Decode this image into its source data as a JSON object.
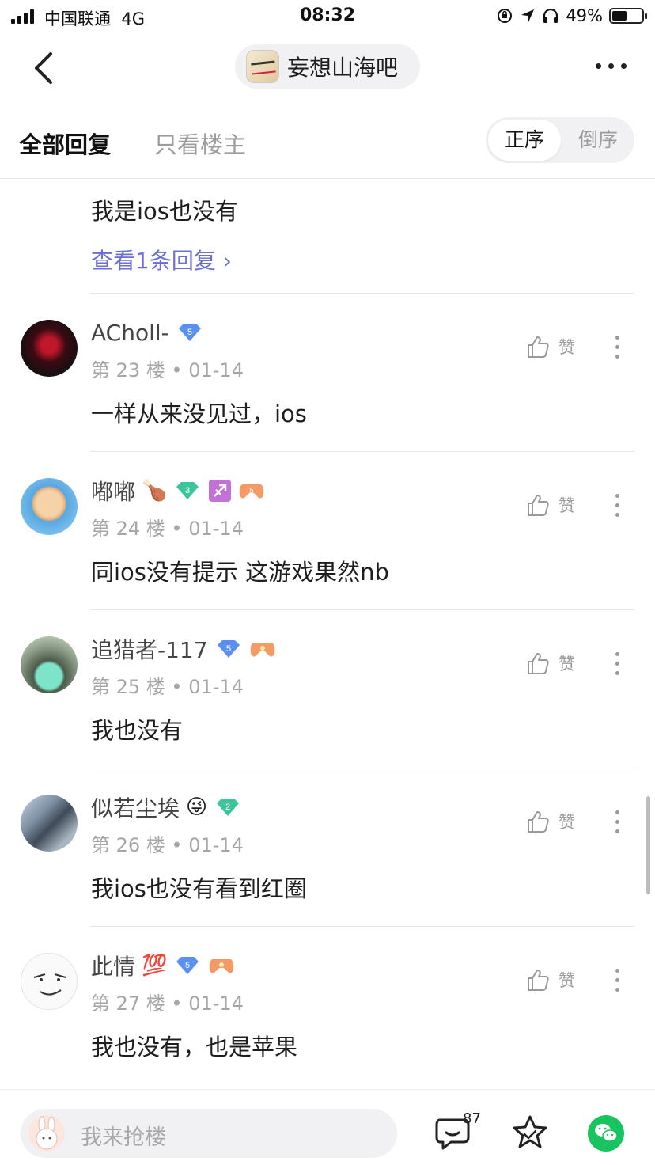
{
  "status_bar": {
    "carrier": "中国联通",
    "network": "4G",
    "time": "08:32",
    "battery": "49%",
    "battery_level": 0.49
  },
  "header": {
    "forum_name": "妄想山海吧"
  },
  "tabs": {
    "all_replies": "全部回复",
    "op_only": "只看楼主",
    "sort_asc": "正序",
    "sort_desc": "倒序"
  },
  "partial_reply": {
    "text": "我是ios也没有",
    "view_replies": "查看1条回复 ›"
  },
  "like_label": "赞",
  "posts": [
    {
      "username": "ACholl-",
      "floor": "第 23 楼",
      "date": "01-14",
      "body": "一样从来没见过，ios",
      "level": "5"
    },
    {
      "username": "嘟嘟",
      "floor": "第 24 楼",
      "date": "01-14",
      "body": "同ios没有提示 这游戏果然nb",
      "level": "3",
      "extra_badge": "5"
    },
    {
      "username": "追猎者-117",
      "floor": "第 25 楼",
      "date": "01-14",
      "body": "我也没有",
      "level": "5"
    },
    {
      "username": "似若尘埃",
      "floor": "第 26 楼",
      "date": "01-14",
      "body": "我ios也没有看到红圈",
      "level": "2"
    },
    {
      "username": "此情",
      "floor": "第 27 楼",
      "date": "01-14",
      "body": "我也没有，也是苹果",
      "level": "5"
    }
  ],
  "bottom_bar": {
    "reply_placeholder": "我来抢楼",
    "comment_count": "87"
  },
  "colors": {
    "accent_link": "#6a6fd1",
    "wechat_green": "#18c45f",
    "gem_blue": "#5b8ff0",
    "gem_green": "#3cc49a"
  }
}
